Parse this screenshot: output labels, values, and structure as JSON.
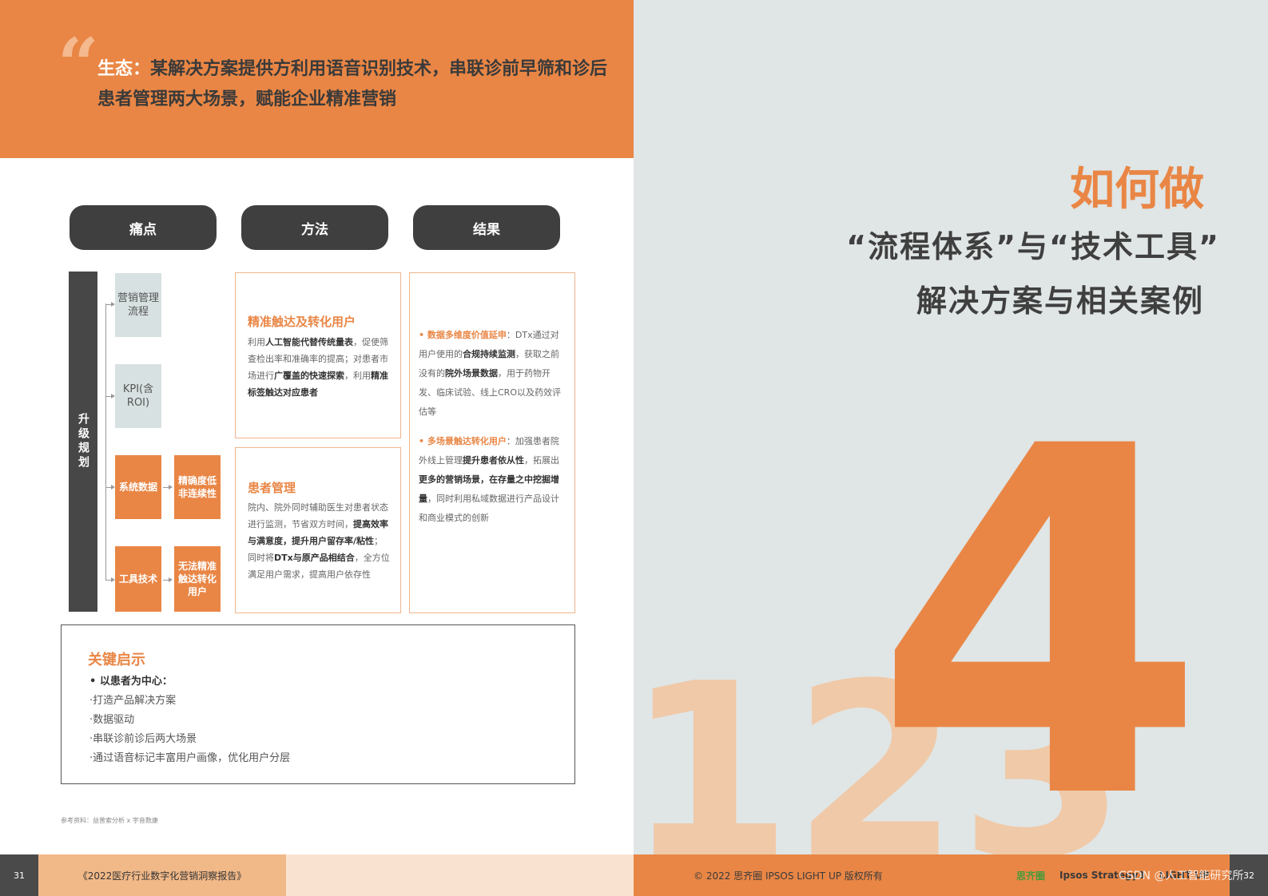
{
  "banner": {
    "quote_mark": "“",
    "label": "生态：",
    "text": "某解决方案提供方利用语音识别技术，串联诊前早筛和诊后患者管理两大场景，赋能企业精准营销"
  },
  "columns": {
    "pain": "痛点",
    "method": "方法",
    "result": "结果"
  },
  "upgrade_label": "升级规划",
  "pain_items": {
    "marketing": "营销管理流程",
    "kpi": "KPI(含ROI)",
    "system": "系统数据",
    "system_issue": "精确度低非连续性",
    "tools": "工具技术",
    "tools_issue": "无法精准触达转化用户"
  },
  "method_cards": [
    {
      "title": "精准触达及转化用户",
      "p1": "利用",
      "b1": "人工智能代替传统量表",
      "p2": "，促使筛查检出率和准确率的提高；对患者市场进行",
      "b2": "广覆盖的快速探索",
      "p3": "，利用",
      "b3": "精准标签触达对应患者"
    },
    {
      "title": "患者管理",
      "p1": "院内、院外同时辅助医生对患者状态进行监测，节省双方时间，",
      "b1": "提高效率与满意度，提升用户留存率/粘性",
      "p2": "；同时将",
      "b2": "DTx与原产品相结合",
      "p3": "，全方位满足用户需求，提高用户依存性"
    }
  ],
  "result_card": {
    "item1_title": "数据多维度价值延申",
    "item1_p1": "：DTx通过对用户使用的",
    "item1_b1": "合规持续监测",
    "item1_p2": "，获取之前没有的",
    "item1_b2": "院外场景数据",
    "item1_p3": "，用于药物开发、临床试验、线上CRO以及药效评估等",
    "item2_title": "多场景触达转化用户",
    "item2_p1": "：加强患者院外线上管理",
    "item2_b1": "提升患者依从性",
    "item2_p2": "，拓展出",
    "item2_b2": "更多的营销场景，在存量之中挖掘增量",
    "item2_p3": "，同时利用私域数据进行产品设计和商业模式的创新"
  },
  "key_insight": {
    "title": "关键启示",
    "lead": "• 以患者为中心：",
    "items": [
      "·打造产品解决方案",
      "·数据驱动",
      "·串联诊前诊后两大场景",
      "·通过语音标记丰富用户画像，优化用户分层"
    ]
  },
  "reference": "参考资料：益普索分析 x 宇音数康",
  "footer": {
    "left_page_num": "31",
    "left_title": "《2022医疗行业数字化营销洞察报告》",
    "right_copyright": "© 2022 思齐圈 IPSOS LIGHT UP 版权所有",
    "logo1": "思齐圈",
    "logo2": "Ipsos Strategy3",
    "logo3": "LIGHT UP",
    "right_page_num": "32",
    "watermark": "CSDN @人工智能研究所"
  },
  "right_page": {
    "title": "如何做",
    "subtitle_line1": "“流程体系”与“技术工具”",
    "subtitle_line2": "解决方案与相关案例",
    "big_digits": "123",
    "big_four": "4"
  },
  "colors": {
    "accent": "#e98645",
    "dark": "#3f3f3f",
    "light_bg": "#e0e5e5",
    "peach": "#f0c9a8"
  }
}
